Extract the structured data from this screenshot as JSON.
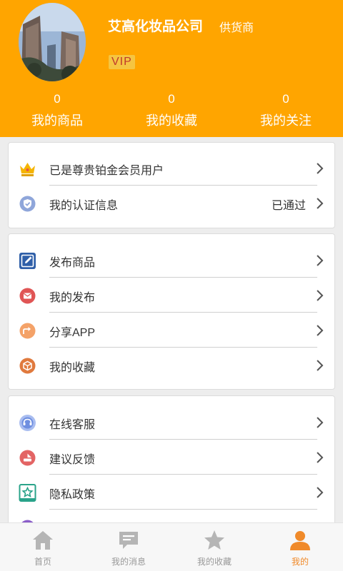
{
  "header": {
    "company_name": "艾高化妆品公司",
    "role": "供货商",
    "vip_badge": "VIP",
    "stats": [
      {
        "value": "0",
        "label": "我的商品"
      },
      {
        "value": "0",
        "label": "我的收藏"
      },
      {
        "value": "0",
        "label": "我的关注"
      }
    ]
  },
  "account": {
    "items": [
      {
        "icon": "crown-icon",
        "label": "已是尊贵铂金会员用户",
        "value": ""
      },
      {
        "icon": "shield-check-icon",
        "label": "我的认证信息",
        "value": "已通过"
      }
    ]
  },
  "actions": {
    "items": [
      {
        "icon": "edit-icon",
        "label": "发布商品"
      },
      {
        "icon": "mail-icon",
        "label": "我的发布"
      },
      {
        "icon": "share-icon",
        "label": "分享APP"
      },
      {
        "icon": "box-icon",
        "label": "我的收藏"
      }
    ]
  },
  "support": {
    "items": [
      {
        "icon": "headset-icon",
        "label": "在线客服"
      },
      {
        "icon": "feedback-icon",
        "label": "建议反馈"
      },
      {
        "icon": "privacy-icon",
        "label": "隐私政策"
      }
    ]
  },
  "tabbar": {
    "tabs": [
      {
        "icon": "home-icon",
        "label": "首页"
      },
      {
        "icon": "message-icon",
        "label": "我的消息"
      },
      {
        "icon": "star-icon",
        "label": "我的收藏"
      },
      {
        "icon": "user-icon",
        "label": "我的",
        "active": true
      }
    ]
  },
  "colors": {
    "header_bg": "#ffa500",
    "active_tab": "#f08a2a",
    "tab_inactive": "#b5b5b5"
  }
}
